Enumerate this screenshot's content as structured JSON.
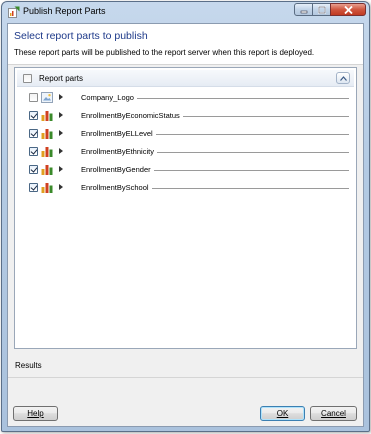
{
  "window": {
    "title": "Publish Report Parts",
    "buttons": [
      "minimize",
      "maximize",
      "close"
    ]
  },
  "header": {
    "title": "Select report parts to publish",
    "description": "These report parts will be published to the report server when this report is deployed."
  },
  "panel": {
    "group_label": "Report parts",
    "group_checked": false,
    "items": [
      {
        "name": "Company_Logo",
        "checked": false,
        "icon": "image-icon"
      },
      {
        "name": "EnrollmentByEconomicStatus",
        "checked": true,
        "icon": "chart-icon"
      },
      {
        "name": "EnrollmentByELLevel",
        "checked": true,
        "icon": "chart-icon"
      },
      {
        "name": "EnrollmentByEthnicity",
        "checked": true,
        "icon": "chart-icon"
      },
      {
        "name": "EnrollmentByGender",
        "checked": true,
        "icon": "chart-icon"
      },
      {
        "name": "EnrollmentBySchool",
        "checked": true,
        "icon": "chart-icon"
      }
    ]
  },
  "results": {
    "label": "Results"
  },
  "footer": {
    "help_label": "Help",
    "ok_label": "OK",
    "cancel_label": "Cancel"
  },
  "colors": {
    "title_text": "#1e3a8a",
    "close_button": "#c03b22"
  }
}
